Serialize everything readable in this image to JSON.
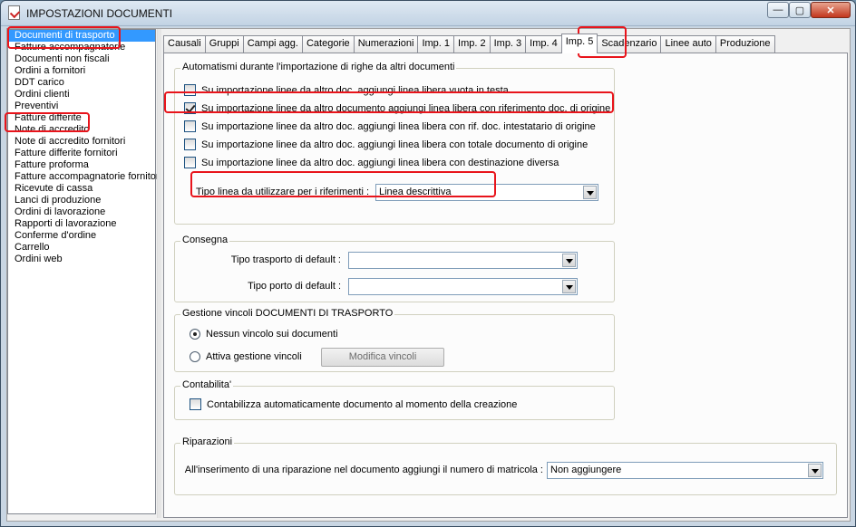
{
  "window": {
    "title": "IMPOSTAZIONI DOCUMENTI",
    "close_glyph": "✕",
    "min_glyph": "—",
    "max_glyph": "▢"
  },
  "doc_list": [
    "Documenti di trasporto",
    "Fatture accompagnatorie",
    "Documenti non fiscali",
    "Ordini a fornitori",
    "DDT carico",
    "Ordini clienti",
    "Preventivi",
    "Fatture differite",
    "Note di accredito",
    "Note di accredito fornitori",
    "Fatture differite fornitori",
    "Fatture proforma",
    "Fatture accompagnatorie fornitori",
    "Ricevute di cassa",
    "Lanci di produzione",
    "Ordini di lavorazione",
    "Rapporti di lavorazione",
    "Conferme d'ordine",
    "Carrello",
    "Ordini web"
  ],
  "doc_list_selected": 0,
  "tabs": [
    "Causali",
    "Gruppi",
    "Campi agg.",
    "Categorie",
    "Numerazioni",
    "Imp. 1",
    "Imp. 2",
    "Imp. 3",
    "Imp. 4",
    "Imp. 5",
    "Scadenzario",
    "Linee auto",
    "Produzione"
  ],
  "active_tab": "Imp. 5",
  "automatismi": {
    "title": "Automatismi durante l'importazione di righe da altri documenti",
    "options": [
      {
        "label": "Su importazione linee da altro doc. aggiungi linea libera vuota in testa",
        "checked": false
      },
      {
        "label": "Su importazione linee da altro documento aggiungi linea libera con riferimento doc. di origine",
        "checked": true
      },
      {
        "label": "Su importazione linee da altro doc. aggiungi linea libera con rif. doc. intestatario di origine",
        "checked": false
      },
      {
        "label": "Su importazione linee da altro doc. aggiungi linea libera con totale documento di origine",
        "checked": false
      },
      {
        "label": "Su importazione linee da altro doc. aggiungi linea libera con destinazione diversa",
        "checked": false
      }
    ],
    "tipo_linea_label": "Tipo linea da utilizzare per i riferimenti :",
    "tipo_linea_value": "Linea descrittiva"
  },
  "consegna": {
    "title": "Consegna",
    "trasporto_label": "Tipo trasporto di default :",
    "trasporto_value": "",
    "porto_label": "Tipo porto di default :",
    "porto_value": ""
  },
  "vincoli": {
    "title": "Gestione vincoli DOCUMENTI DI TRASPORTO",
    "radio_none": "Nessun vincolo sui documenti",
    "radio_attiva": "Attiva gestione vincoli",
    "selected": "none",
    "modifica_button": "Modifica vincoli"
  },
  "contabilita": {
    "title": "Contabilita'",
    "option": "Contabilizza automaticamente documento al momento della creazione",
    "checked": false
  },
  "riparazioni": {
    "title": "Riparazioni",
    "label": "All'inserimento di una riparazione nel documento aggiungi il numero di matricola :",
    "value": "Non aggiungere"
  }
}
